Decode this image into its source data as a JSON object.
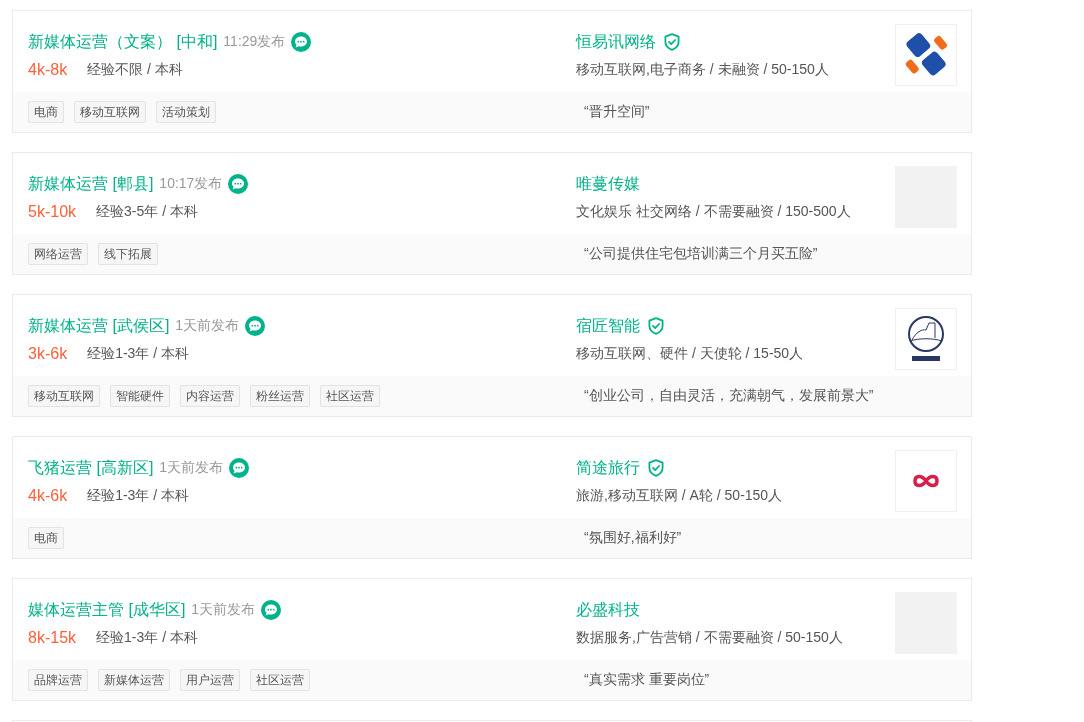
{
  "jobs": [
    {
      "title": "新媒体运营（文案） [中和]",
      "time": "11:29发布",
      "salary": "4k-8k",
      "requirements": "经验不限 / 本科",
      "tags": [
        "电商",
        "移动互联网",
        "活动策划"
      ],
      "company": {
        "name": "恒易讯网络",
        "verified": true,
        "info": "移动互联网,电子商务 / 未融资 / 50-150人",
        "logo": {
          "kind": "tiles"
        }
      },
      "slogan": "“晋升空间”"
    },
    {
      "title": "新媒体运营 [郫县]",
      "time": "10:17发布",
      "salary": "5k-10k",
      "requirements": "经验3-5年 / 本科",
      "tags": [
        "网络运营",
        "线下拓展"
      ],
      "company": {
        "name": "唯蔓传媒",
        "verified": false,
        "info": "文化娱乐 社交网络 / 不需要融资 / 150-500人",
        "logo": {
          "kind": "placeholder"
        }
      },
      "slogan": "“公司提供住宅包培训满三个月买五险”"
    },
    {
      "title": "新媒体运营 [武侯区]",
      "time": "1天前发布",
      "salary": "3k-6k",
      "requirements": "经验1-3年 / 本科",
      "tags": [
        "移动互联网",
        "智能硬件",
        "内容运营",
        "粉丝运营",
        "社区运营"
      ],
      "company": {
        "name": "宿匠智能",
        "verified": true,
        "info": "移动互联网、硬件 / 天使轮 / 15-50人",
        "logo": {
          "kind": "emblem"
        }
      },
      "slogan": "“创业公司，自由灵活，充满朝气，发展前景大”"
    },
    {
      "title": "飞猪运营 [高新区]",
      "time": "1天前发布",
      "salary": "4k-6k",
      "requirements": "经验1-3年 / 本科",
      "tags": [
        "电商"
      ],
      "company": {
        "name": "简途旅行",
        "verified": true,
        "info": "旅游,移动互联网 / A轮 / 50-150人",
        "logo": {
          "kind": "infinity"
        }
      },
      "slogan": "“氛围好,福利好”"
    },
    {
      "title": "媒体运营主管 [成华区]",
      "time": "1天前发布",
      "salary": "8k-15k",
      "requirements": "经验1-3年 / 本科",
      "tags": [
        "品牌运营",
        "新媒体运营",
        "用户运营",
        "社区运营"
      ],
      "company": {
        "name": "必盛科技",
        "verified": false,
        "info": "数据服务,广告营销 / 不需要融资 / 50-150人",
        "logo": {
          "kind": "placeholder"
        }
      },
      "slogan": "“真实需求 重要岗位”"
    }
  ]
}
